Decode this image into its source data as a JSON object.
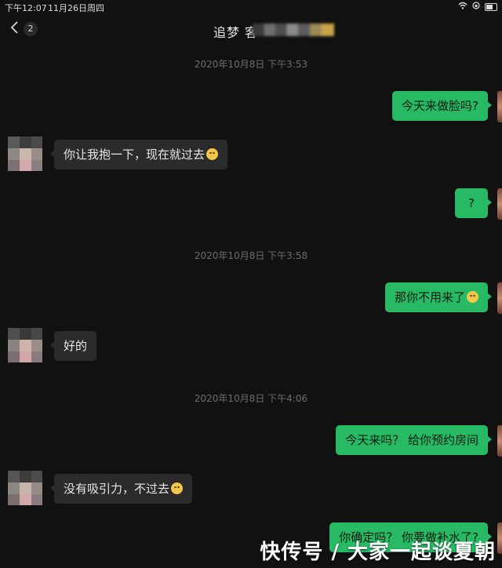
{
  "status_bar": {
    "time": "下午12:07",
    "date": "11月26日周四"
  },
  "nav": {
    "back_count": "2",
    "title": "追梦 客"
  },
  "messages": [
    {
      "kind": "timestamp",
      "text": "2020年10月8日 下午3:53"
    },
    {
      "kind": "me",
      "text": "今天来做脸吗?"
    },
    {
      "kind": "them",
      "text": "你让我抱一下，现在就过去",
      "emoji": "smile-emoji"
    },
    {
      "kind": "me",
      "text": "?"
    },
    {
      "kind": "timestamp",
      "text": "2020年10月8日 下午3:58"
    },
    {
      "kind": "me",
      "text": "那你不用来了",
      "emoji": "laugh-emoji"
    },
    {
      "kind": "them",
      "text": "好的"
    },
    {
      "kind": "timestamp",
      "text": "2020年10月8日 下午4:06"
    },
    {
      "kind": "me",
      "text": "今天来吗？ 给你预约房间"
    },
    {
      "kind": "them",
      "text": "没有吸引力，不过去",
      "emoji": "smile-emoji"
    },
    {
      "kind": "me",
      "text": "你确定吗？ 你要做补水了?"
    }
  ],
  "watermark": "快传号 / 大家一起谈夏朝",
  "colors": {
    "background": "#111111",
    "my_bubble": "#28b964",
    "their_bubble": "#2b2b2b",
    "timestamp_text": "#6d6d6d"
  }
}
